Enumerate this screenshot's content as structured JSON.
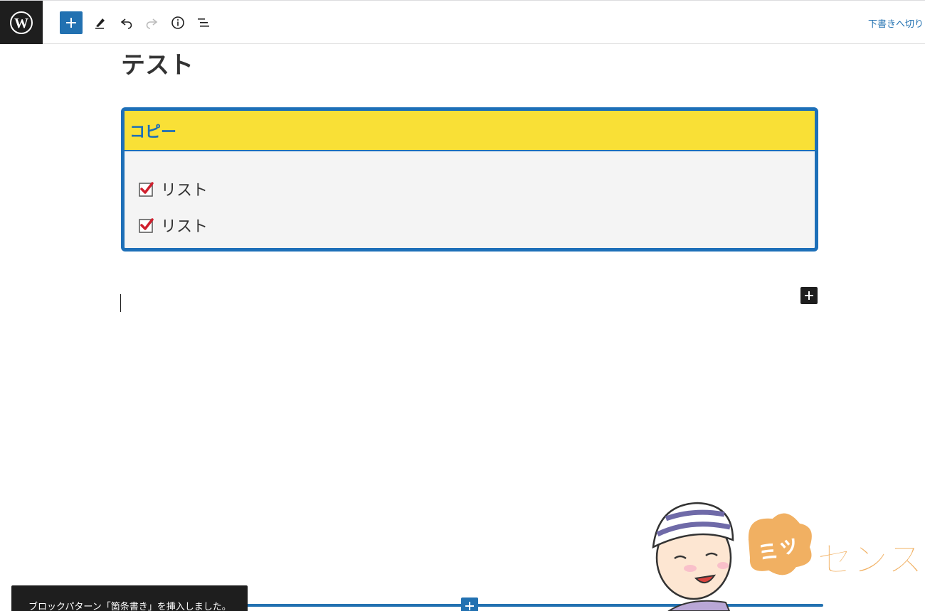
{
  "toolbar": {
    "logo_icon": "wordpress-icon",
    "icons": [
      "plus-icon",
      "pencil-icon",
      "undo-icon",
      "redo-icon",
      "info-icon",
      "list-view-icon"
    ],
    "accent_color": "#2271b1",
    "save_draft_label": "下書きへ切り"
  },
  "post": {
    "title": "テスト"
  },
  "box": {
    "header": "コピー",
    "header_bg": "#f9e036",
    "border_color": "#1d6fb8",
    "items": [
      {
        "label": "リスト",
        "icon": "checkbox-checked-icon"
      },
      {
        "label": "リスト",
        "icon": "checkbox-checked-icon"
      }
    ]
  },
  "snackbar": {
    "message": "ブロックパターン「箇条書き」を挿入しました。"
  },
  "watermark": {
    "text": "センス",
    "logo_text": "ミッ"
  }
}
